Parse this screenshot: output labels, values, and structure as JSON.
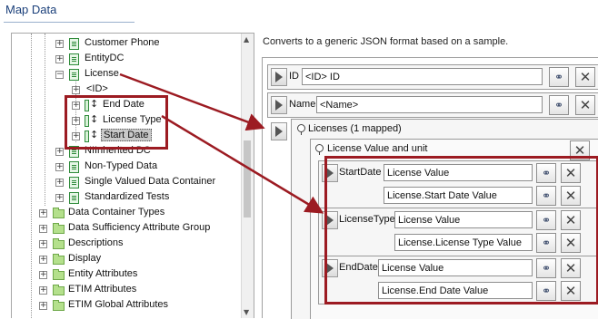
{
  "header": {
    "title": "Map Data"
  },
  "tree": {
    "items": [
      {
        "label": "Customer Phone"
      },
      {
        "label": "EntityDC"
      },
      {
        "label": "License"
      },
      {
        "label": "<ID>"
      },
      {
        "label": "End Date"
      },
      {
        "label": "License Type"
      },
      {
        "label": "Start Date"
      },
      {
        "label": "NIInherited DC"
      },
      {
        "label": "Non-Typed Data"
      },
      {
        "label": "Single Valued Data Container"
      },
      {
        "label": "Standardized Tests"
      },
      {
        "label": "Data Container Types"
      },
      {
        "label": "Data Sufficiency Attribute Group"
      },
      {
        "label": "Descriptions"
      },
      {
        "label": "Display"
      },
      {
        "label": "Entity Attributes"
      },
      {
        "label": "ETIM Attributes"
      },
      {
        "label": "ETIM Global Attributes"
      }
    ],
    "expand_glyph": "+",
    "collapse_glyph": "−",
    "attr_icon_glyph": "↕",
    "scroll_up_glyph": "▲",
    "scroll_down_glyph": "▼"
  },
  "mapper": {
    "description": "Converts to a generic JSON format based on a sample.",
    "id_row": {
      "label": "ID",
      "value": "<ID> ID"
    },
    "name_row": {
      "label": "Name",
      "value": "<Name>"
    },
    "licenses_group": {
      "label": "Licenses (1 mapped)"
    },
    "value_unit_group": {
      "label": "License Value and unit"
    },
    "mappings": [
      {
        "label": "StartDate",
        "source": "License Value",
        "target": "License.Start Date Value"
      },
      {
        "label": "LicenseType",
        "source": "License Value",
        "target": "License.License Type Value"
      },
      {
        "label": "EndDate",
        "source": "License Value",
        "target": "License.End Date Value"
      }
    ],
    "remove_glyph": "✕",
    "link_glyph": "⚭"
  },
  "colors": {
    "annotation": "#9c1b22",
    "title": "#1a3f7a",
    "tree_icon": "#2e8b3a",
    "folder": "#b4e08c"
  },
  "icons": [
    "expand-icon",
    "collapse-icon",
    "data-container-icon",
    "attribute-icon",
    "folder-icon",
    "map-play-icon",
    "link-icon",
    "remove-icon",
    "lightbulb-icon"
  ]
}
